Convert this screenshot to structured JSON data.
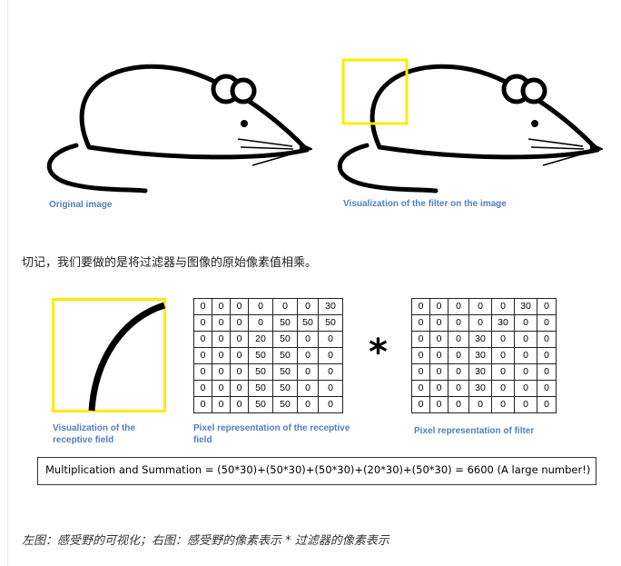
{
  "top": {
    "caption_original": "Original image",
    "caption_filter": "Visualization of the filter on the image"
  },
  "sentence": "切记，我们要做的是将过滤器与图像的原始像素值相乘。",
  "figure": {
    "caption_receptive": [
      "Visualization of the",
      "receptive field"
    ],
    "caption_pixels": [
      "Pixel representation of the receptive",
      "field"
    ],
    "caption_filter": "Pixel representation of filter",
    "operator": "*",
    "receptive_grid": [
      [
        "0",
        "0",
        "0",
        "0",
        "0",
        "0",
        "30"
      ],
      [
        "0",
        "0",
        "0",
        "0",
        "50",
        "50",
        "50"
      ],
      [
        "0",
        "0",
        "0",
        "20",
        "50",
        "0",
        "0"
      ],
      [
        "0",
        "0",
        "0",
        "50",
        "50",
        "0",
        "0"
      ],
      [
        "0",
        "0",
        "0",
        "50",
        "50",
        "0",
        "0"
      ],
      [
        "0",
        "0",
        "0",
        "50",
        "50",
        "0",
        "0"
      ],
      [
        "0",
        "0",
        "0",
        "50",
        "50",
        "0",
        "0"
      ]
    ],
    "filter_grid": [
      [
        "0",
        "0",
        "0",
        "0",
        "0",
        "30",
        "0"
      ],
      [
        "0",
        "0",
        "0",
        "0",
        "30",
        "0",
        "0"
      ],
      [
        "0",
        "0",
        "0",
        "30",
        "0",
        "0",
        "0"
      ],
      [
        "0",
        "0",
        "0",
        "30",
        "0",
        "0",
        "0"
      ],
      [
        "0",
        "0",
        "0",
        "30",
        "0",
        "0",
        "0"
      ],
      [
        "0",
        "0",
        "0",
        "30",
        "0",
        "0",
        "0"
      ],
      [
        "0",
        "0",
        "0",
        "0",
        "0",
        "0",
        "0"
      ]
    ],
    "formula": "Multiplication and Summation = (50*30)+(50*30)+(50*30)+(20*30)+(50*30) = 6600 (A large number!)"
  },
  "bottom_caption": "左图：感受野的可视化；右图：感受野的像素表示 * 过滤器的像素表示",
  "colors": {
    "caption_blue": "#4f81bd",
    "highlight_yellow": "#ffeb00"
  }
}
